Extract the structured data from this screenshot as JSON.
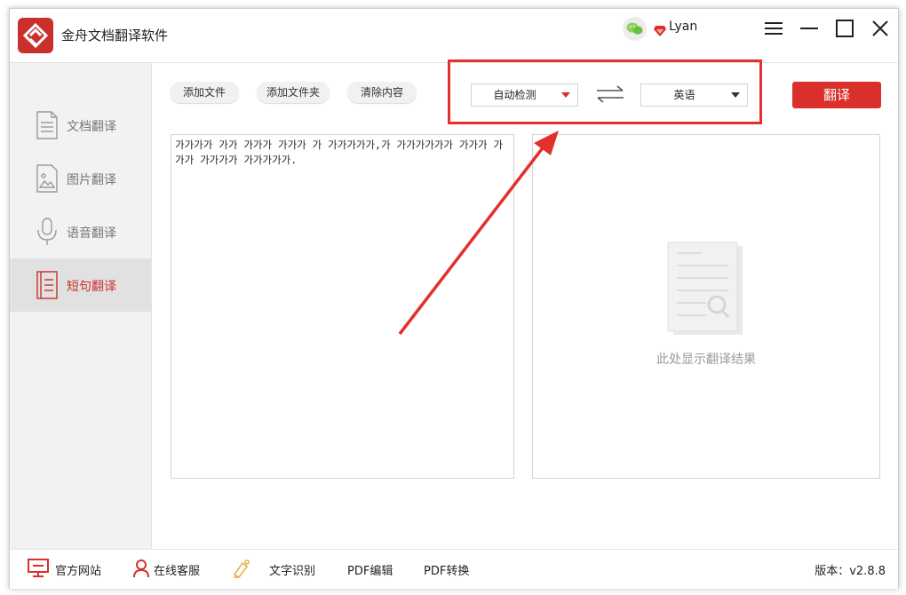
{
  "app": {
    "title": "金舟文档翻译软件",
    "username": "Lyan"
  },
  "sidebar": {
    "items": [
      {
        "label": "文档翻译",
        "active": false,
        "icon": "document-icon"
      },
      {
        "label": "图片翻译",
        "active": false,
        "icon": "image-icon"
      },
      {
        "label": "语音翻译",
        "active": false,
        "icon": "microphone-icon"
      },
      {
        "label": "短句翻译",
        "active": true,
        "icon": "short-text-icon"
      }
    ]
  },
  "toolbar": {
    "add_file": "添加文件",
    "add_folder": "添加文件夹",
    "clear": "清除内容",
    "source_lang": "自动检测",
    "target_lang": "英语",
    "translate": "翻译"
  },
  "source_text": "가가가가 가가 가가가 가가가 가 가가가가가,가 가가가가가가 가가가 가가가 가가가가 가가가가가.",
  "result_placeholder": "此处显示翻译结果",
  "footer": {
    "official_site": "官方网站",
    "online_support": "在线客服",
    "ocr": "文字识别",
    "pdf_edit": "PDF编辑",
    "pdf_convert": "PDF转换",
    "version": "版本：v2.8.8"
  },
  "colors": {
    "accent": "#d9302c",
    "annotation": "#e2312c"
  }
}
